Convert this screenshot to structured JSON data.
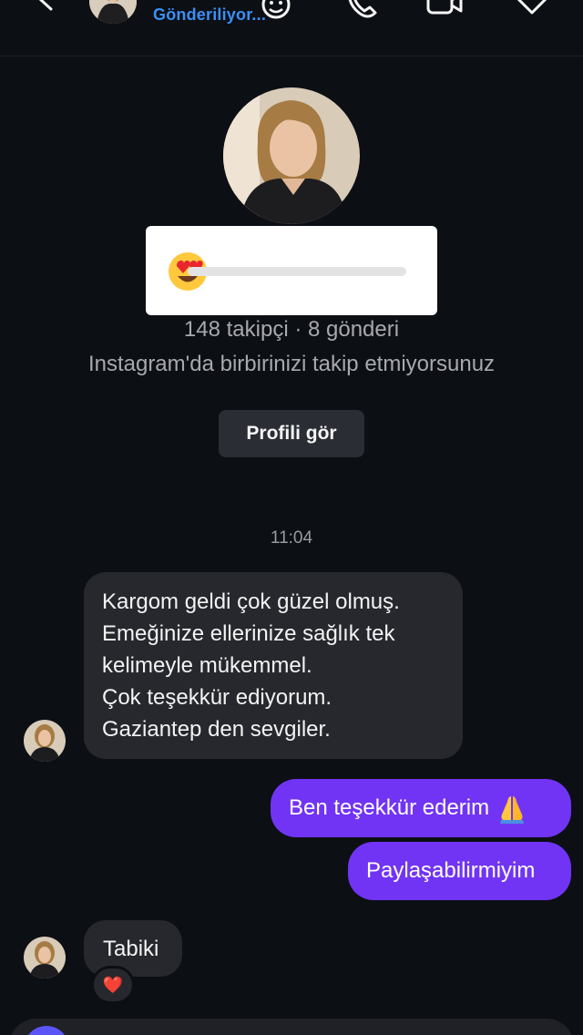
{
  "header": {
    "status_text": "Gönderiliyor...",
    "icons": [
      "back-icon",
      "sticker-icon",
      "phone-icon",
      "video-icon",
      "flag-icon"
    ]
  },
  "profile": {
    "stats": "148 takipçi · 8 gönderi",
    "mutual": "Instagram'da birbirinizi takip etmiyorsunuz",
    "view_button": "Profili gör"
  },
  "poll": {
    "emoji": "heart-eyes-emoji",
    "slider_level": 0
  },
  "timestamp": "11:04",
  "messages": {
    "m1_lines": [
      "Kargom geldi çok güzel olmuş.",
      "Emeğinize ellerinize sağlık tek",
      "kelimeyle mükemmel.",
      "Çok teşekkür ediyorum.",
      "Gaziantep den sevgiler."
    ],
    "m2": "Ben teşekkür ederim",
    "m3": "Paylaşabilirmiyim",
    "m4": "Tabiki",
    "m4_reaction": "❤️"
  },
  "colors": {
    "background": "#0c0f14",
    "incoming_bubble": "#26282d",
    "outgoing_bubble": "#7134f5",
    "link_blue": "#3b8ff6",
    "muted_text": "#a8a9ad"
  }
}
